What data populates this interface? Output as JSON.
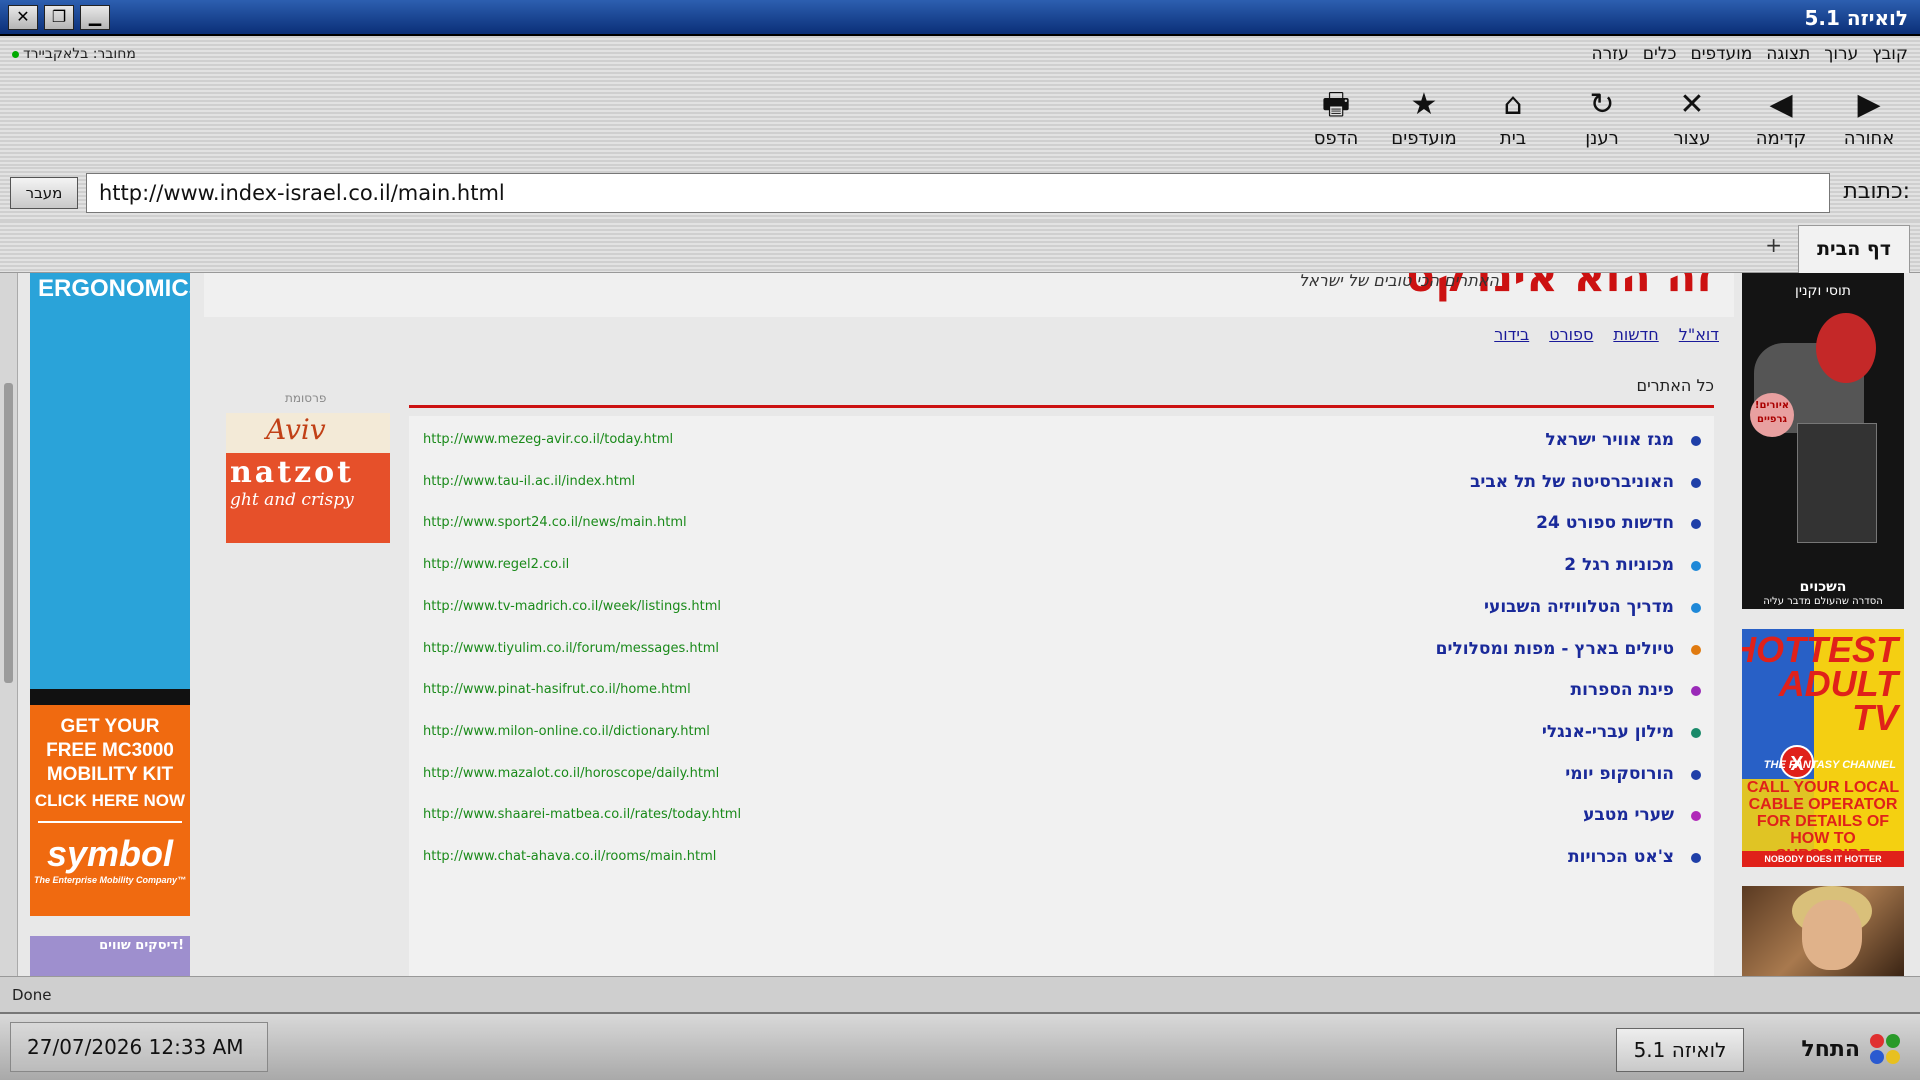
{
  "window": {
    "title": "לואיזה 5.1",
    "close": "✕",
    "restore": "❐",
    "minimize": "▁"
  },
  "menu": {
    "items": [
      "קובץ",
      "ערוך",
      "תצוגה",
      "מועדפים",
      "כלים",
      "עזרה"
    ],
    "connection": "מחובר: בלאקביירד"
  },
  "toolbar": {
    "back": {
      "icon": "▶",
      "label": "אחורה"
    },
    "forward": {
      "icon": "◀",
      "label": "קדימה"
    },
    "stop": {
      "icon": "✕",
      "label": "עצור"
    },
    "refresh": {
      "icon": "↻",
      "label": "רענן"
    },
    "home": {
      "icon": "⌂",
      "label": "בית"
    },
    "favorites": {
      "icon": "★",
      "label": "מועדפים"
    },
    "print": {
      "icon": "🖶",
      "label": "הדפס"
    }
  },
  "address": {
    "label": "כתובת:",
    "url": "http://www.index-israel.co.il/main.html",
    "go": "מעבר"
  },
  "tabs": {
    "home": "דף הבית",
    "new": "+"
  },
  "page": {
    "logo": "זה הוא אינדקס",
    "tagline": "האתרים הכי טובים של ישראל",
    "nav": [
      "דוא\"ל",
      "חדשות",
      "ספורט",
      "בידור"
    ],
    "all_sites": "כל האתרים",
    "ad_label": "פרסומת",
    "sites": [
      {
        "title": "מגז אוויר ישראל",
        "url": "http://www.mezeg-avir.co.il/today.html",
        "color": "#1f3fa8"
      },
      {
        "title": "האוניברסיטה של תל אביב",
        "url": "http://www.tau-il.ac.il/index.html",
        "color": "#1f3fa8"
      },
      {
        "title": "חדשות ספורט 24",
        "url": "http://www.sport24.co.il/news/main.html",
        "color": "#1f3fa8"
      },
      {
        "title": "מכוניות רגל 2",
        "url": "http://www.regel2.co.il",
        "color": "#1e88d8"
      },
      {
        "title": "מדריך הטלוויזיה השבועי",
        "url": "http://www.tv-madrich.co.il/week/listings.html",
        "color": "#1e88d8"
      },
      {
        "title": "טיולים בארץ - מפות ומסלולים",
        "url": "http://www.tiyulim.co.il/forum/messages.html",
        "color": "#e07a10"
      },
      {
        "title": "פינת הספרות",
        "url": "http://www.pinat-hasifrut.co.il/home.html",
        "color": "#9a2ab8"
      },
      {
        "title": "מילון עברי-אנגלי",
        "url": "http://www.milon-online.co.il/dictionary.html",
        "color": "#1a8a6a"
      },
      {
        "title": "הורוסקופ יומי",
        "url": "http://www.mazalot.co.il/horoscope/daily.html",
        "color": "#1f3fa8"
      },
      {
        "title": "שערי מטבע",
        "url": "http://www.shaarei-matbea.co.il/rates/today.html",
        "color": "#b028b8"
      },
      {
        "title": "צ'אט הכרויות",
        "url": "http://www.chat-ahava.co.il/rooms/main.html",
        "color": "#1f3fa8"
      }
    ]
  },
  "ads": {
    "ergo": "ERGONOMICS.",
    "symbol_line1": "GET YOUR",
    "symbol_line2": "FREE MC3000",
    "symbol_line3": "MOBILITY KIT",
    "symbol_cta": "CLICK HERE NOW",
    "symbol_brand": "symbol",
    "symbol_tag": "The Enterprise Mobility Company™",
    "disks": "דיסקים שווים!",
    "aviv": "Aviv",
    "aviv_word": "natzot",
    "aviv_tag": "ght and crispy",
    "book_top": "תוסי וקנין",
    "book_badge": "!איורים גרפיים",
    "book_bottom": "השכוים",
    "book_sub": "הסדרה שהעולם מדבר עליה",
    "tv_title": "HOTTEST ADULT TV",
    "tv_channel": "THE FANTASY CHANNEL",
    "tv_call": "CALL YOUR LOCAL CABLE OPERATOR FOR DETAILS OF HOW TO SUBSCRIBE",
    "tv_foot": "NOBODY DOES IT HOTTER"
  },
  "status": "Done",
  "taskbar": {
    "start": "התחל",
    "app": "לואיזה 5.1",
    "datetime": "27/07/2026   12:33 AM"
  }
}
